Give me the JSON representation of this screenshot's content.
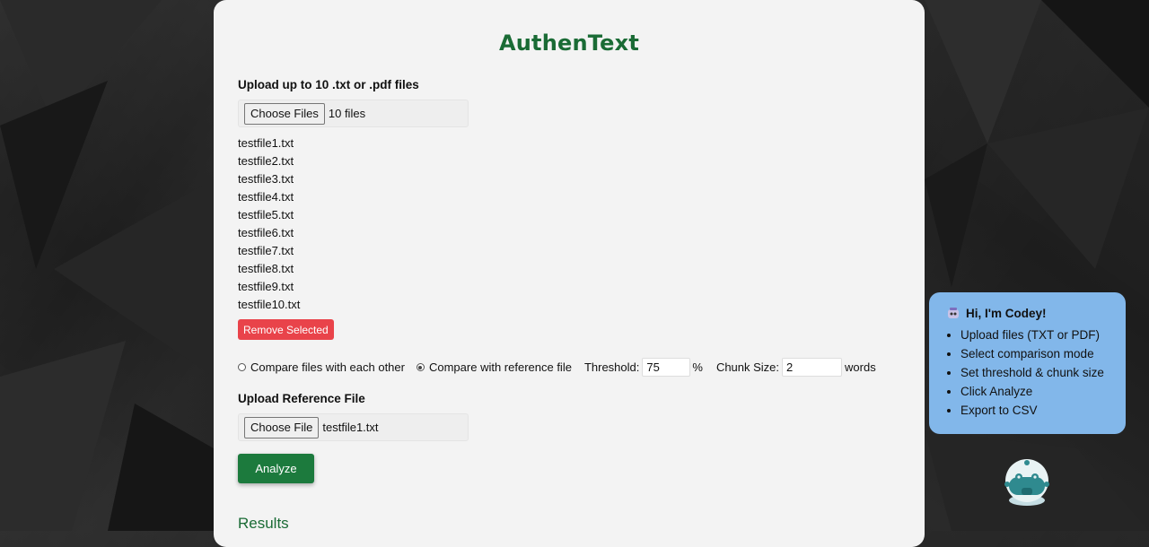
{
  "app": {
    "title": "AuthenText"
  },
  "upload": {
    "label": "Upload up to 10 .txt or .pdf files",
    "button_label": "Choose Files",
    "status": "10 files",
    "files": [
      "testfile1.txt",
      "testfile2.txt",
      "testfile3.txt",
      "testfile4.txt",
      "testfile5.txt",
      "testfile6.txt",
      "testfile7.txt",
      "testfile8.txt",
      "testfile9.txt",
      "testfile10.txt"
    ],
    "remove_label": "Remove Selected"
  },
  "options": {
    "mode_each_other": "Compare files with each other",
    "mode_reference": "Compare with reference file",
    "selected_mode": "reference",
    "threshold_label": "Threshold:",
    "threshold_value": "75",
    "threshold_unit": "%",
    "chunk_label": "Chunk Size:",
    "chunk_value": "2",
    "chunk_unit": "words"
  },
  "reference": {
    "label": "Upload Reference File",
    "button_label": "Choose File",
    "status": "testfile1.txt"
  },
  "analyze_label": "Analyze",
  "results_heading": "Results",
  "assistant": {
    "greeting": "Hi, I'm Codey!",
    "tips": [
      "Upload files (TXT or PDF)",
      "Select comparison mode",
      "Set threshold & chunk size",
      "Click Analyze",
      "Export to CSV"
    ]
  },
  "colors": {
    "accent": "#1a6b35",
    "button": "#1c7a3d",
    "danger": "#e9434a",
    "assistant_bg": "#82b7ea"
  },
  "icons": {
    "assistant": "robot-icon"
  }
}
